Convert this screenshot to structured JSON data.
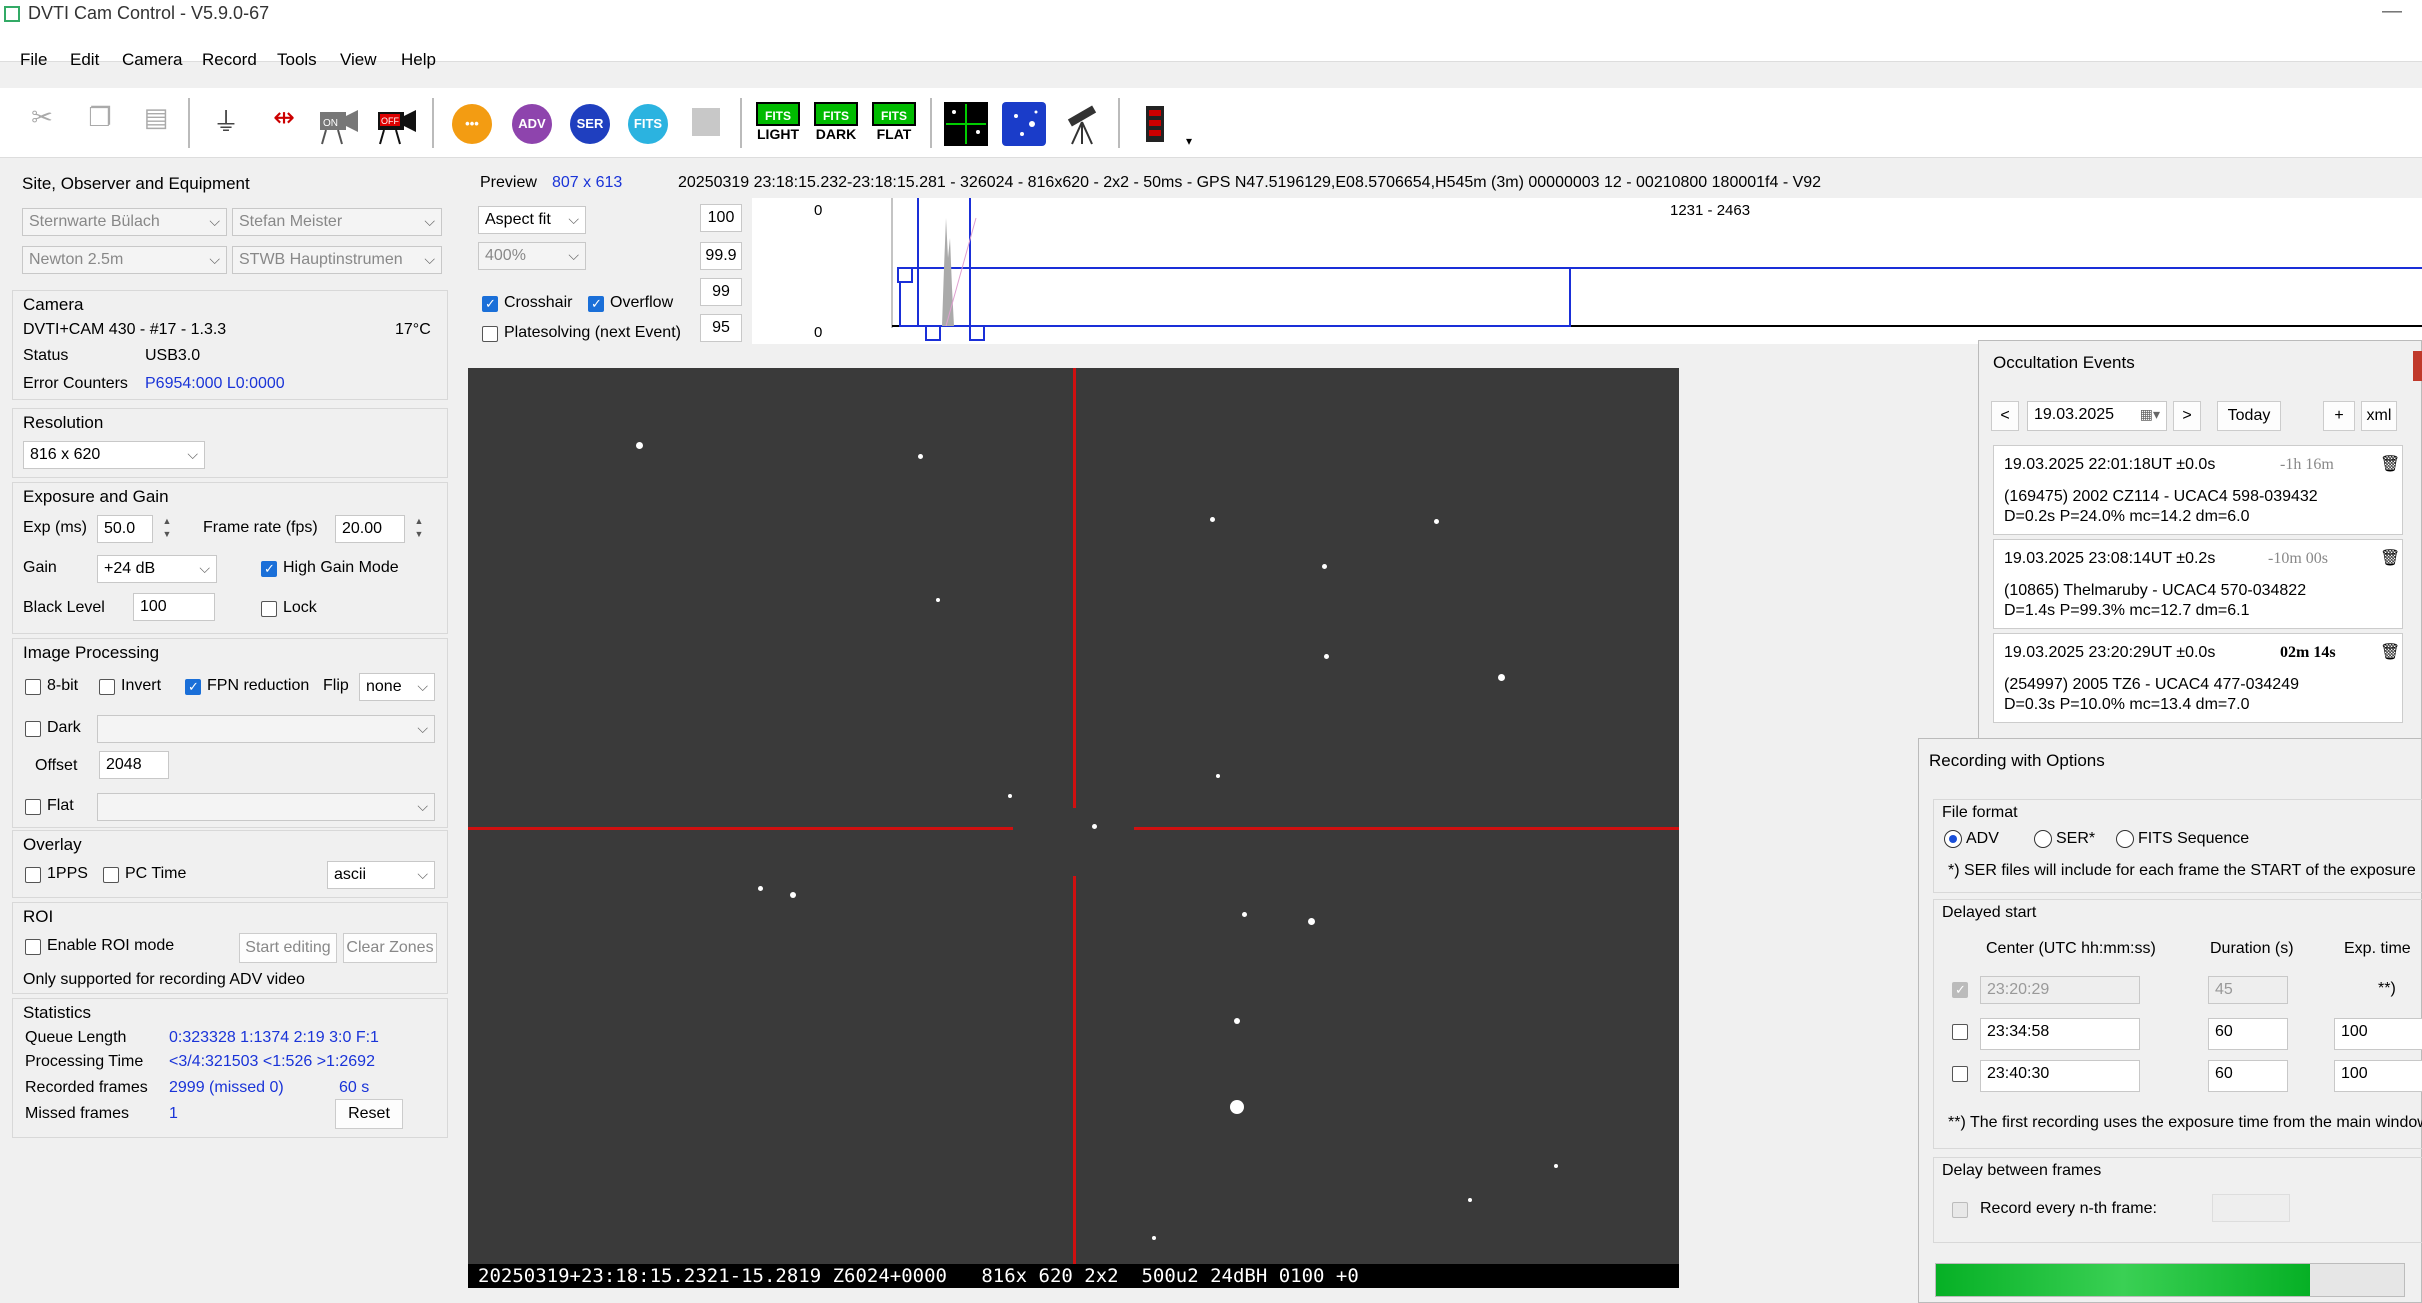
{
  "window": {
    "title": "DVTI Cam Control - V5.9.0-67"
  },
  "menu": [
    "File",
    "Edit",
    "Camera",
    "Record",
    "Tools",
    "View",
    "Help"
  ],
  "toolbar": {
    "circles": [
      {
        "label": "•••",
        "color": "#f39c12"
      },
      {
        "label": "ADV",
        "color": "#8e44ad"
      },
      {
        "label": "SER",
        "color": "#1f3fbf"
      },
      {
        "label": "FITS",
        "color": "#2bb3e0"
      }
    ],
    "fits_buttons": [
      {
        "top": "FITS",
        "bottom": "LIGHT"
      },
      {
        "top": "FITS",
        "bottom": "DARK"
      },
      {
        "top": "FITS",
        "bottom": "FLAT"
      }
    ]
  },
  "site": {
    "title": "Site, Observer and Equipment",
    "site": "Sternwarte Bülach",
    "observer": "Stefan Meister",
    "telescope": "Newton 2.5m",
    "instrument": "STWB Hauptinstrumen"
  },
  "camera": {
    "title": "Camera",
    "model": "DVTI+CAM 430  -  #17  -  1.3.3",
    "temp": "17°C",
    "status_label": "Status",
    "status_value": "USB3.0",
    "errors_label": "Error Counters",
    "errors_value": "P6954:000 L0:0000"
  },
  "resolution": {
    "title": "Resolution",
    "value": "816 x 620"
  },
  "exposure": {
    "title": "Exposure and Gain",
    "exp_label": "Exp (ms)",
    "exp_value": "50.0",
    "fps_label": "Frame rate (fps)",
    "fps_value": "20.00",
    "gain_label": "Gain",
    "gain_value": "+24 dB",
    "high_gain": "High Gain Mode",
    "black_label": "Black Level",
    "black_value": "100",
    "lock": "Lock"
  },
  "image_proc": {
    "title": "Image Processing",
    "bit8": "8-bit",
    "invert": "Invert",
    "fpn": "FPN reduction",
    "flip_label": "Flip",
    "flip_value": "none",
    "dark": "Dark",
    "offset_label": "Offset",
    "offset_value": "2048",
    "flat": "Flat"
  },
  "overlay": {
    "title": "Overlay",
    "pps": "1PPS",
    "pctime": "PC Time",
    "format": "ascii"
  },
  "roi": {
    "title": "ROI",
    "enable": "Enable ROI mode",
    "start": "Start editing",
    "clear": "Clear Zones",
    "note": "Only supported for recording ADV video"
  },
  "stats": {
    "title": "Statistics",
    "queue_label": "Queue Length",
    "queue_value": "0:323328  1:1374  2:19  3:0  F:1",
    "proc_label": "Processing Time",
    "proc_value": "<3/4:321503  <1:526  >1:2692",
    "rec_label": "Recorded frames",
    "rec_value": "2999 (missed 0)",
    "rec_time": "60 s",
    "missed_label": "Missed frames",
    "missed_value": "1",
    "reset": "Reset"
  },
  "preview": {
    "label": "Preview",
    "size": "807 x 613",
    "info": "20250319 23:18:15.232-23:18:15.281 - 326024 - 816x620 - 2x2 - 50ms - GPS N47.5196129,E08.5706654,H545m (3m) 00000003 12 - 00210800 180001f4 - V92",
    "fit": "Aspect fit",
    "zoom": "400%",
    "crosshair": "Crosshair",
    "overflow": "Overflow",
    "platesolve": "Platesolving (next Event)",
    "levels": [
      "100",
      "99.9",
      "99",
      "95"
    ],
    "hist_top": "0",
    "hist_bottom": "0",
    "hist_range": "1231 - 2463",
    "overlay_text": "20250319+23:18:15.2321-15.2819 Z6024+0000   816x 620 2x2  500u2 24dBH 0100 +0"
  },
  "occultation": {
    "title": "Occultation Events",
    "date": "19.03.2025",
    "prev": "<",
    "next": ">",
    "today": "Today",
    "add": "+",
    "xml": "xml",
    "events": [
      {
        "time": "19.03.2025 22:01:18UT ±0.0s",
        "rel": "-1h 16m",
        "obj": "(169475) 2002 CZ114 - UCAC4 598-039432",
        "params": "D=0.2s  P=24.0%  mc=14.2  dm=6.0"
      },
      {
        "time": "19.03.2025 23:08:14UT ±0.2s",
        "rel": "-10m 00s",
        "obj": "(10865) Thelmaruby - UCAC4 570-034822",
        "params": "D=1.4s  P=99.3%  mc=12.7  dm=6.1"
      },
      {
        "time": "19.03.2025 23:20:29UT ±0.0s",
        "rel": "02m 14s",
        "obj": "(254997) 2005 TZ6 - UCAC4 477-034249",
        "params": "D=0.3s  P=10.0%  mc=13.4  dm=7.0"
      }
    ]
  },
  "recording": {
    "title": "Recording with Options",
    "file_format": "File format",
    "adv": "ADV",
    "ser": "SER*",
    "fits": "FITS Sequence",
    "ser_note": "*) SER files will include for each frame the START of the exposure",
    "delayed": "Delayed start",
    "col_center": "Center (UTC hh:mm:ss)",
    "col_duration": "Duration (s)",
    "col_exp": "Exp. time",
    "rows": [
      {
        "center": "23:20:29",
        "duration": "45",
        "exp": "**)"
      },
      {
        "center": "23:34:58",
        "duration": "60",
        "exp": "100"
      },
      {
        "center": "23:40:30",
        "duration": "60",
        "exp": "100"
      }
    ],
    "exp_note": "**) The first recording uses the exposure time from the main window",
    "delay_frames": "Delay between frames",
    "nth": "Record every n-th frame:",
    "progress": 0.8
  }
}
